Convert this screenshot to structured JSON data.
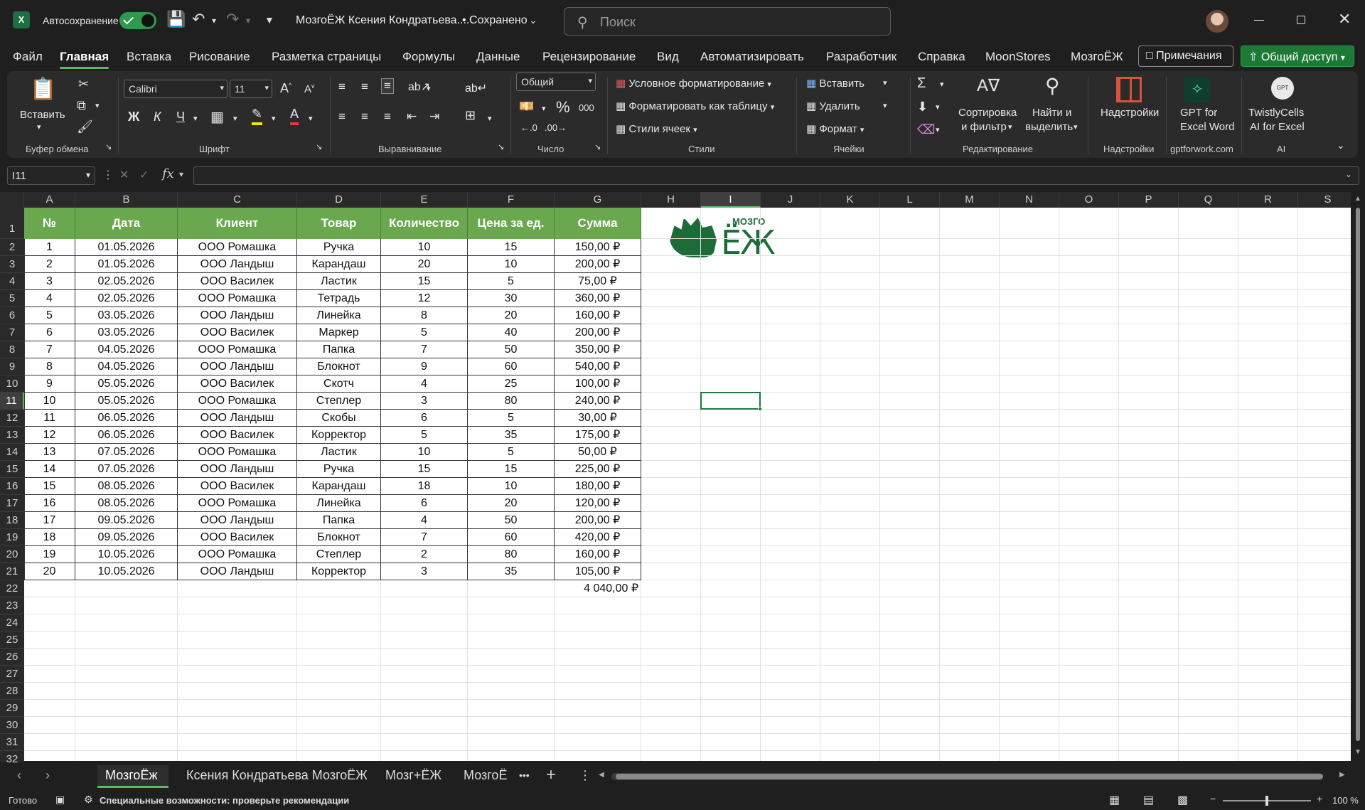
{
  "titlebar": {
    "autosave_label": "Автосохранение",
    "doc_title": "МозгоЁЖ Ксения Кондратьева....",
    "saved_status": "• Сохранено",
    "search_placeholder": "Поиск"
  },
  "menu": {
    "items": [
      "Файл",
      "Главная",
      "Вставка",
      "Рисование",
      "Разметка страницы",
      "Формулы",
      "Данные",
      "Рецензирование",
      "Вид",
      "Автоматизировать",
      "Разработчик",
      "Справка",
      "MoonStores",
      "МозгоЁЖ"
    ],
    "notes_label": "Примечания",
    "share_label": "Общий доступ"
  },
  "ribbon": {
    "paste_label": "Вставить",
    "clipboard_label": "Буфер обмена",
    "font_name": "Calibri",
    "font_size": "11",
    "bold": "Ж",
    "italic": "К",
    "underline": "Ч",
    "font_label": "Шрифт",
    "alignment_label": "Выравнивание",
    "number_format": "Общий",
    "number_label": "Число",
    "cond_format": "Условное форматирование",
    "format_table": "Форматировать как таблицу",
    "cell_styles": "Стили ячеек",
    "styles_label": "Стили",
    "insert": "Вставить",
    "delete": "Удалить",
    "format": "Формат",
    "cells_label": "Ячейки",
    "sort_filter_1": "Сортировка",
    "sort_filter_2": "и фильтр",
    "find_1": "Найти и",
    "find_2": "выделить",
    "editing_label": "Редактирование",
    "addins": "Надстройки",
    "addins_label": "Надстройки",
    "gpt_1": "GPT for",
    "gpt_2": "Excel Word",
    "gpt_label": "gptforwork.com",
    "twistly_1": "TwistlyCells",
    "twistly_2": "AI for Excel",
    "ai_label": "AI",
    "percent": "%",
    "thousands": "000"
  },
  "formula_bar": {
    "name_box": "I11",
    "fx": "fx",
    "value": ""
  },
  "columns": [
    "A",
    "B",
    "C",
    "D",
    "E",
    "F",
    "G",
    "H",
    "I",
    "J",
    "K",
    "L",
    "M",
    "N",
    "O",
    "P",
    "Q",
    "R",
    "S"
  ],
  "selected_col": "I",
  "selected_row": 11,
  "table": {
    "headers": [
      "№",
      "Дата",
      "Клиент",
      "Товар",
      "Количество",
      "Цена за ед.",
      "Сумма"
    ],
    "rows": [
      [
        "1",
        "01.05.2026",
        "ООО Ромашка",
        "Ручка",
        "10",
        "15",
        "150,00 ₽"
      ],
      [
        "2",
        "01.05.2026",
        "ООО Ландыш",
        "Карандаш",
        "20",
        "10",
        "200,00 ₽"
      ],
      [
        "3",
        "02.05.2026",
        "ООО Василек",
        "Ластик",
        "15",
        "5",
        "75,00 ₽"
      ],
      [
        "4",
        "02.05.2026",
        "ООО Ромашка",
        "Тетрадь",
        "12",
        "30",
        "360,00 ₽"
      ],
      [
        "5",
        "03.05.2026",
        "ООО Ландыш",
        "Линейка",
        "8",
        "20",
        "160,00 ₽"
      ],
      [
        "6",
        "03.05.2026",
        "ООО Василек",
        "Маркер",
        "5",
        "40",
        "200,00 ₽"
      ],
      [
        "7",
        "04.05.2026",
        "ООО Ромашка",
        "Папка",
        "7",
        "50",
        "350,00 ₽"
      ],
      [
        "8",
        "04.05.2026",
        "ООО Ландыш",
        "Блокнот",
        "9",
        "60",
        "540,00 ₽"
      ],
      [
        "9",
        "05.05.2026",
        "ООО Василек",
        "Скотч",
        "4",
        "25",
        "100,00 ₽"
      ],
      [
        "10",
        "05.05.2026",
        "ООО Ромашка",
        "Степлер",
        "3",
        "80",
        "240,00 ₽"
      ],
      [
        "11",
        "06.05.2026",
        "ООО Ландыш",
        "Скобы",
        "6",
        "5",
        "30,00 ₽"
      ],
      [
        "12",
        "06.05.2026",
        "ООО Василек",
        "Корректор",
        "5",
        "35",
        "175,00 ₽"
      ],
      [
        "13",
        "07.05.2026",
        "ООО Ромашка",
        "Ластик",
        "10",
        "5",
        "50,00 ₽"
      ],
      [
        "14",
        "07.05.2026",
        "ООО Ландыш",
        "Ручка",
        "15",
        "15",
        "225,00 ₽"
      ],
      [
        "15",
        "08.05.2026",
        "ООО Василек",
        "Карандаш",
        "18",
        "10",
        "180,00 ₽"
      ],
      [
        "16",
        "08.05.2026",
        "ООО Ромашка",
        "Линейка",
        "6",
        "20",
        "120,00 ₽"
      ],
      [
        "17",
        "09.05.2026",
        "ООО Ландыш",
        "Папка",
        "4",
        "50",
        "200,00 ₽"
      ],
      [
        "18",
        "09.05.2026",
        "ООО Василек",
        "Блокнот",
        "7",
        "60",
        "420,00 ₽"
      ],
      [
        "19",
        "10.05.2026",
        "ООО Ромашка",
        "Степлер",
        "2",
        "80",
        "160,00 ₽"
      ],
      [
        "20",
        "10.05.2026",
        "ООО Ландыш",
        "Корректор",
        "3",
        "35",
        "105,00 ₽"
      ]
    ],
    "total": "4 040,00 ₽"
  },
  "logo": {
    "top_text": "МОЗГО",
    "main_text": "ЁЖ",
    "color": "#1e6b3a"
  },
  "tabs": [
    "МозгоЁж",
    "Ксения Кондратьева МозгоЁЖ",
    "Мозг+ЁЖ",
    "МозгоЁ"
  ],
  "tabs_more": "•••",
  "status": {
    "ready": "Готово",
    "accessibility": "Специальные возможности: проверьте рекомендации",
    "zoom": "100 %"
  },
  "colors": {
    "header_green": "#6aa84f",
    "accent": "#5fb85f",
    "share_green": "#1c7a35"
  }
}
